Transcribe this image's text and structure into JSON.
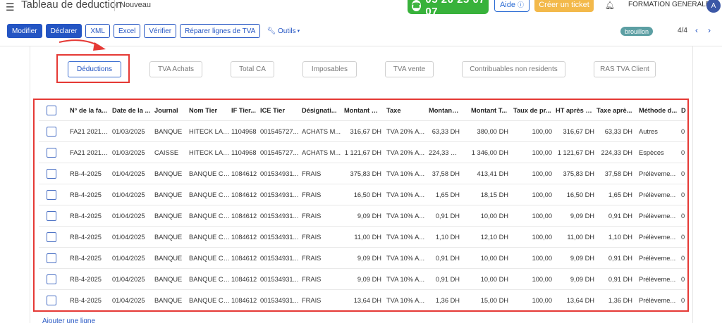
{
  "header": {
    "title": "Tableau de deduction",
    "status": "Nouveau",
    "phone": "05 20 25 07 07",
    "help_label": "Aide",
    "help_icon": "question-circle-icon",
    "ticket_label": "Créer un ticket",
    "company": "FORMATION GENERALE",
    "avatar_letter": "A"
  },
  "toolbar": {
    "modify": "Modifier",
    "declare": "Déclarer",
    "xml": "XML",
    "excel": "Excel",
    "verify": "Vérifier",
    "repair": "Réparer lignes de TVA",
    "tools": "Outils",
    "draft_badge": "brouillon",
    "pager": "4/4"
  },
  "tabs": [
    {
      "label": "Déductions",
      "active": true
    },
    {
      "label": "TVA Achats",
      "active": false
    },
    {
      "label": "Total CA",
      "active": false
    },
    {
      "label": "Imposables",
      "active": false
    },
    {
      "label": "TVA vente",
      "active": false
    },
    {
      "label": "Contribuables non residents",
      "active": false
    },
    {
      "label": "RAS TVA Client",
      "active": false
    }
  ],
  "table": {
    "columns": [
      "N° de la fa...",
      "Date de la ...",
      "Journal",
      "Nom Tier",
      "IF Tier...",
      "ICE Tier",
      "Désignati...",
      "Montant H...",
      "Taxe",
      "Montant T...",
      "Montant T...",
      "Taux de pr...",
      "HT après p...",
      "Taxe aprè...",
      "Méthode d...",
      "D"
    ],
    "rows": [
      [
        "FA21 20210...",
        "01/03/2025",
        "BANQUE",
        "HITECK LAND",
        "1104968",
        "001545727...",
        "ACHATS M...",
        "316,67 DH",
        "TVA 20% A...",
        "63,33 DH",
        "380,00 DH",
        "100,00",
        "316,67 DH",
        "63,33 DH",
        "Autres",
        "0"
      ],
      [
        "FA21 20210...",
        "01/03/2025",
        "CAISSE",
        "HITECK LAND",
        "1104968",
        "001545727...",
        "ACHATS M...",
        "1 121,67 DH",
        "TVA 20% A...",
        "224,33 DH",
        "1 346,00 DH",
        "100,00",
        "1 121,67 DH",
        "224,33 DH",
        "Espèces",
        "0"
      ],
      [
        "RB-4-2025",
        "01/04/2025",
        "BANQUE",
        "BANQUE CE...",
        "1084612",
        "001534931...",
        "FRAIS",
        "375,83 DH",
        "TVA 10% A...",
        "37,58 DH",
        "413,41 DH",
        "100,00",
        "375,83 DH",
        "37,58 DH",
        "Prélèveme...",
        "0"
      ],
      [
        "RB-4-2025",
        "01/04/2025",
        "BANQUE",
        "BANQUE CE...",
        "1084612",
        "001534931...",
        "FRAIS",
        "16,50 DH",
        "TVA 10% A...",
        "1,65 DH",
        "18,15 DH",
        "100,00",
        "16,50 DH",
        "1,65 DH",
        "Prélèveme...",
        "0"
      ],
      [
        "RB-4-2025",
        "01/04/2025",
        "BANQUE",
        "BANQUE CE...",
        "1084612",
        "001534931...",
        "FRAIS",
        "9,09 DH",
        "TVA 10% A...",
        "0,91 DH",
        "10,00 DH",
        "100,00",
        "9,09 DH",
        "0,91 DH",
        "Prélèveme...",
        "0"
      ],
      [
        "RB-4-2025",
        "01/04/2025",
        "BANQUE",
        "BANQUE CE...",
        "1084612",
        "001534931...",
        "FRAIS",
        "11,00 DH",
        "TVA 10% A...",
        "1,10 DH",
        "12,10 DH",
        "100,00",
        "11,00 DH",
        "1,10 DH",
        "Prélèveme...",
        "0"
      ],
      [
        "RB-4-2025",
        "01/04/2025",
        "BANQUE",
        "BANQUE CE...",
        "1084612",
        "001534931...",
        "FRAIS",
        "9,09 DH",
        "TVA 10% A...",
        "0,91 DH",
        "10,00 DH",
        "100,00",
        "9,09 DH",
        "0,91 DH",
        "Prélèveme...",
        "0"
      ],
      [
        "RB-4-2025",
        "01/04/2025",
        "BANQUE",
        "BANQUE CE...",
        "1084612",
        "001534931...",
        "FRAIS",
        "9,09 DH",
        "TVA 10% A...",
        "0,91 DH",
        "10,00 DH",
        "100,00",
        "9,09 DH",
        "0,91 DH",
        "Prélèveme...",
        "0"
      ],
      [
        "RB-4-2025",
        "01/04/2025",
        "BANQUE",
        "BANQUE CE...",
        "1084612",
        "001534931...",
        "FRAIS",
        "13,64 DH",
        "TVA 10% A...",
        "1,36 DH",
        "15,00 DH",
        "100,00",
        "13,64 DH",
        "1,36 DH",
        "Prélèveme...",
        "0"
      ]
    ]
  },
  "footer": {
    "add_line": "Ajouter une ligne"
  },
  "colors": {
    "primary": "#2455c3",
    "phone_green": "#38b23b",
    "ticket_orange": "#f3b94a",
    "highlight_red": "#e53935",
    "badge_teal": "#5c9fa3"
  }
}
